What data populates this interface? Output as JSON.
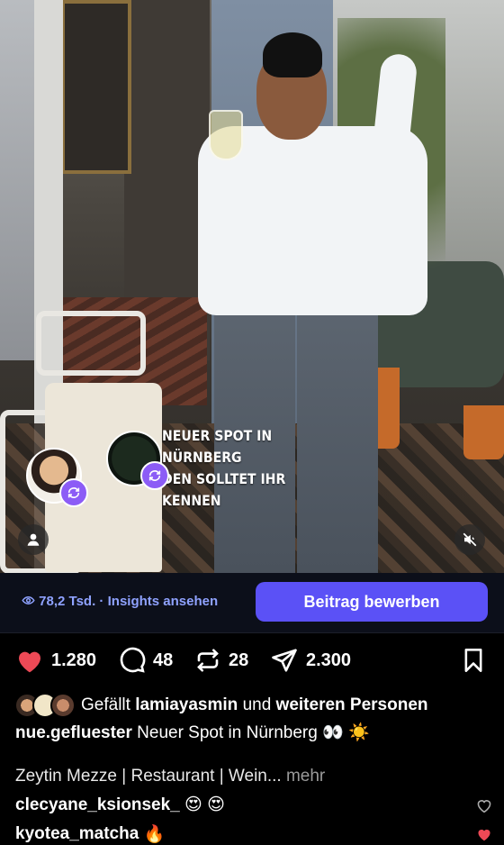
{
  "media": {
    "overlay_line1": "NEUER SPOT IN NÜRNBERG",
    "overlay_line2": "DEN SOLLTET IHR KENNEN",
    "collab_icon": "repost-icon",
    "user_tag_icon": "person-icon",
    "mute_icon": "speaker-muted-icon"
  },
  "insights": {
    "views_icon": "eye-icon",
    "views": "78,2 Tsd.",
    "separator": " · ",
    "insights_link": "Insights ansehen",
    "promote_button": "Beitrag bewerben"
  },
  "actions": {
    "likes": "1.280",
    "comments": "48",
    "reposts": "28",
    "shares": "2.300",
    "like_color": "#ed4956"
  },
  "likes_line": {
    "prefix": "Gefällt",
    "user": "lamiayasmin",
    "middle": "und",
    "suffix": "weiteren Personen"
  },
  "caption": {
    "username": "nue.gefluester",
    "text": "Neuer Spot in Nürnberg 👀 ☀️"
  },
  "description": {
    "text": "Zeytin Mezze | Restaurant | Wein...",
    "more": "mehr"
  },
  "comments": [
    {
      "user": "clecyane_ksionsek_",
      "text": "😍 😍",
      "liked": false
    },
    {
      "user": "kyotea_matcha",
      "text": "🔥",
      "liked": true
    }
  ]
}
